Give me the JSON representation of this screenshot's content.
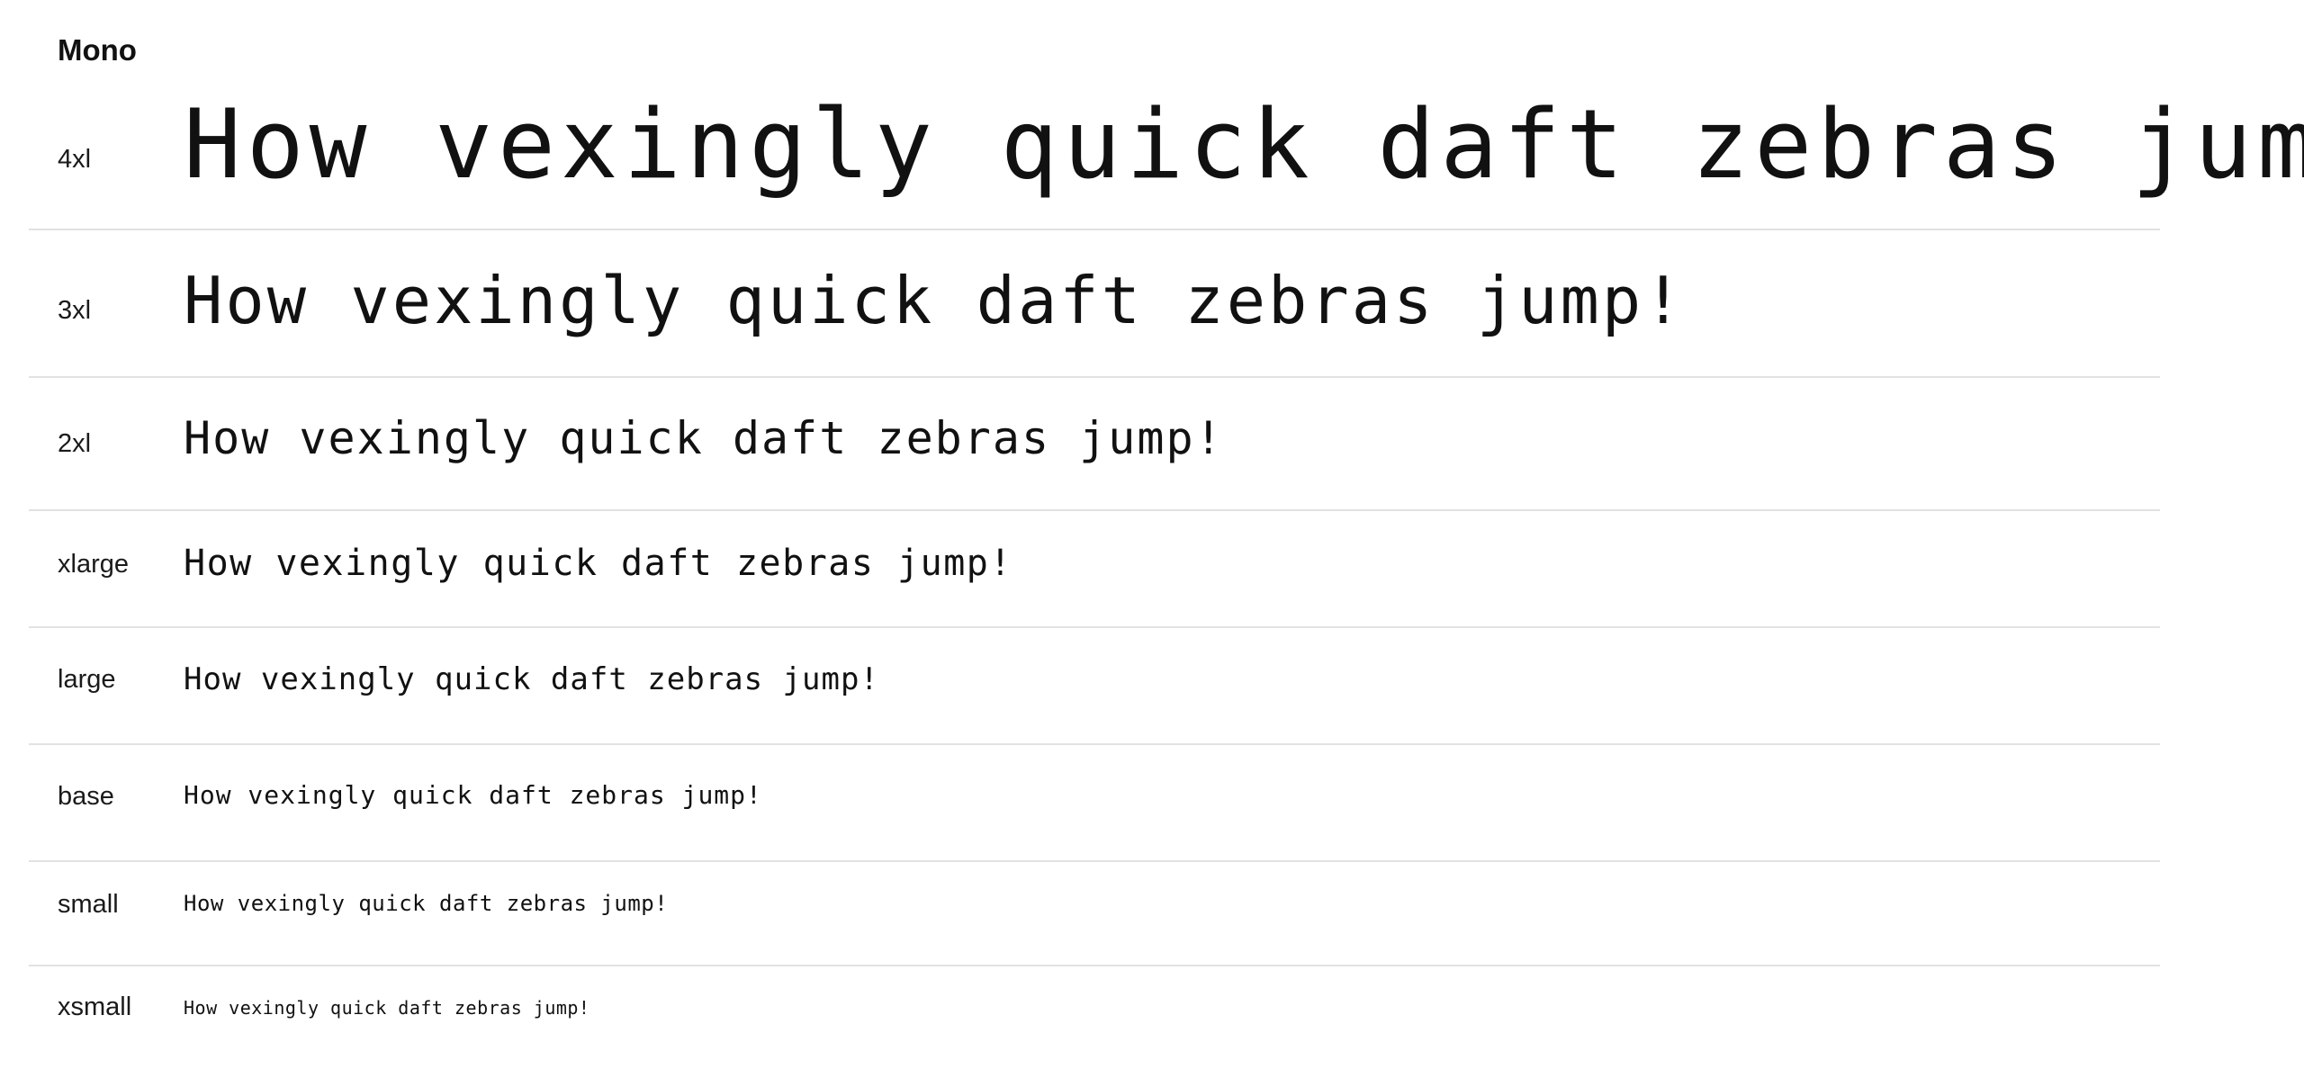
{
  "section": {
    "title": "Mono"
  },
  "rows": [
    {
      "label": "4xl",
      "sample": "How vexingly quick daft zebras jump!"
    },
    {
      "label": "3xl",
      "sample": "How vexingly quick daft zebras jump!"
    },
    {
      "label": "2xl",
      "sample": "How vexingly quick daft zebras jump!"
    },
    {
      "label": "xlarge",
      "sample": "How vexingly quick daft zebras jump!"
    },
    {
      "label": "large",
      "sample": "How vexingly quick daft zebras jump!"
    },
    {
      "label": "base",
      "sample": "How vexingly quick daft zebras jump!"
    },
    {
      "label": "small",
      "sample": "How vexingly quick daft zebras jump!"
    },
    {
      "label": "xsmall",
      "sample": "How vexingly quick daft zebras jump!"
    }
  ],
  "colors": {
    "text": "#111111",
    "divider": "#e2e2e2",
    "background": "#ffffff"
  }
}
